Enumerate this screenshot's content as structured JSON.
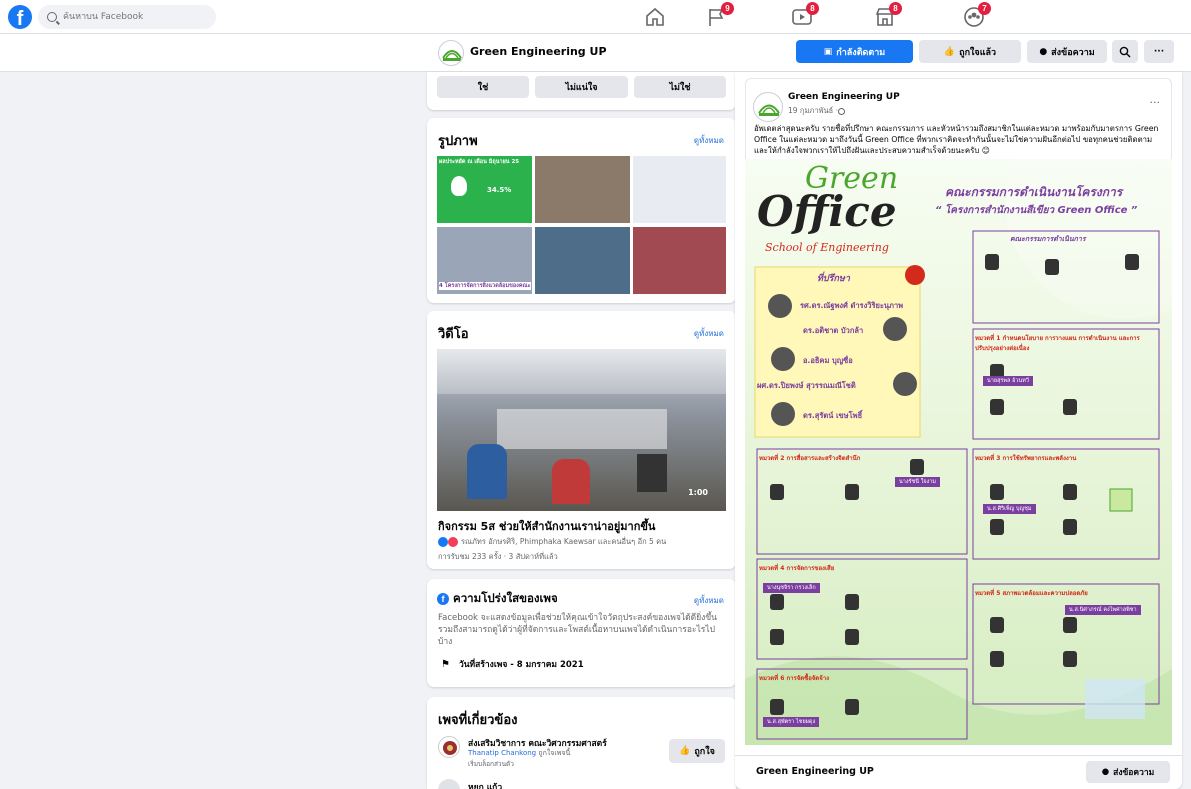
{
  "topbar": {
    "search_placeholder": "ค้นหาบน Facebook",
    "nav": [
      {
        "icon": "home-icon",
        "badge": ""
      },
      {
        "icon": "flag-icon",
        "badge": "9"
      },
      {
        "icon": "watch-icon",
        "badge": "8"
      },
      {
        "icon": "marketplace-icon",
        "badge": "8"
      },
      {
        "icon": "groups-icon",
        "badge": "7"
      }
    ]
  },
  "pagebar": {
    "page_name": "Green Engineering UP",
    "following_label": "กำลังติดตาม",
    "liked_label": "ถูกใจแล้ว",
    "message_label": "ส่งข้อความ",
    "more_label": "···"
  },
  "vote": {
    "options": [
      "ใช่",
      "ไม่แน่ใจ",
      "ไม่ใช่"
    ]
  },
  "photos": {
    "title": "รูปภาพ",
    "see_all": "ดูทั้งหมด",
    "items": [
      {
        "color": "#2bb24c",
        "caption": "ผลประหยัด ณ เดือน มิถุนายน 25",
        "text": "34.5%"
      },
      {
        "color": "#8b7a6a",
        "caption": "",
        "text": ""
      },
      {
        "color": "#e8ebf2",
        "caption": "",
        "text": ""
      },
      {
        "color": "#9aa6b8",
        "caption": "4 โครงการจัดการสิ่งแวดล้อมของคณะ",
        "text": ""
      },
      {
        "color": "#4e6d88",
        "caption": "",
        "text": ""
      },
      {
        "color": "#a24a52",
        "caption": "",
        "text": ""
      }
    ]
  },
  "videos": {
    "title": "วิดีโอ",
    "see_all": "ดูทั้งหมด",
    "duration": "1:00",
    "video_title": "กิจกรรม 5ส ช่วยให้สำนักงานเราน่าอยู่มากขึ้น",
    "reactors": "รณภัทร อักษรศิริ, Phimphaka Kaewsar และคนอื่นๆ อีก 5 คน",
    "meta": "การรับชม 233 ครั้ง · 3 สัปดาห์ที่แล้ว"
  },
  "transparency": {
    "title": "ความโปร่งใสของเพจ",
    "see_all": "ดูทั้งหมด",
    "description": "Facebook จะแสดงข้อมูลเพื่อช่วยให้คุณเข้าใจวัตถุประสงค์ของเพจได้ดียิ่งขึ้น รวมถึงสามารถดูได้ว่าผู้ที่จัดการและโพสต์เนื้อหาบนเพจได้ดำเนินการอะไรไปบ้าง",
    "created": "วันที่สร้างเพจ - 8 มกราคม 2021"
  },
  "related": {
    "title": "เพจที่เกี่ยวข้อง",
    "pages": [
      {
        "name": "ส่งเสริมวิชาการ คณะวิศวกรรมศาสตร์",
        "liker": "Thanatip Chankong",
        "liker_suffix": "ถูกใจเพจนี้",
        "sub": "เริ่มบล็อกส่วนตัว",
        "like_label": "ถูกใจ"
      },
      {
        "name": "หยก แก้ว",
        "liker": "",
        "liker_suffix": "",
        "sub": "",
        "like_label": ""
      }
    ]
  },
  "post": {
    "author": "Green Engineering UP",
    "date": "19 กุมภาพันธ์ · ",
    "text": "อัพเดตล่าสุดนะครับ รายชื่อที่ปรึกษา คณะกรรมการ และหัวหน้ารวมถึงสมาชิกในแต่ละหมวด มาพร้อมกับมาตรการ Green Office ในแต่ละหมวด มาถึงวันนี้ Green Office ที่พวกเราคิดจะทำกันนั้นจะไม่ใช่ความฝันอีกต่อไป ขอทุกคนช่วยติดตามและให้กำลังใจพวกเราให้ไปถึงฝันและประสบความสำเร็จด้วยนะครับ 😊",
    "more_label": "···",
    "footer_name": "Green Engineering UP",
    "footer_message": "ส่งข้อความ"
  },
  "poster": {
    "logo_green": "Green",
    "logo_office": "Office",
    "school": "School of Engineering",
    "heading": "คณะกรรมการดำเนินงานโครงการ",
    "subheading": "“ โครงการสำนักงานสีเขียว Green Office ”",
    "advisors_title": "ที่ปรึกษา",
    "advisors": [
      "รศ.ดร.ณัฐพงศ์ ดำรงวิริยะนุภาพ",
      "ดร.อติชาต บัวกล้า",
      "อ.อธิคม บุญซื่อ",
      "ผศ.ดร.ปิยพงษ์ สุวรรณมณีโชติ",
      "ดร.สุรัตน์ เขษโพธิ์"
    ],
    "committee_title": "คณะกรรมการดำเนินการ",
    "sections": [
      {
        "title": "หมวดที่ 1 กำหนดนโยบาย การวางแผน การดำเนินงาน และการปรับปรุงอย่างต่อเนื่อง",
        "leader": "นายสุรพล อ้วนทวี"
      },
      {
        "title": "หมวดที่ 2 การสื่อสารและสร้างจิตสำนึก",
        "leader": "นางรัชนี ใจงาม"
      },
      {
        "title": "หมวดที่ 3 การใช้ทรัพยากรและพลังงาน",
        "leader": "น.ส.ศิริเพ็ญ บุญชุม"
      },
      {
        "title": "หมวดที่ 4 การจัดการของเสีย",
        "leader": "นางนุชจิรา กรวงเล็ก"
      },
      {
        "title": "หมวดที่ 5 สภาพแวดล้อมและความปลอดภัย",
        "leader": "น.ส.นิศาภรณ์ คงไพศาลพิชา"
      },
      {
        "title": "หมวดที่ 6 การจัดซื้อจัดจ้าง",
        "leader": "น.ส.สุพัตรา ไชยผดุง"
      }
    ]
  },
  "colors": {
    "brand": "#1877f2",
    "badge": "#e41e3f",
    "poster_green": "#4aa72c",
    "poster_purple": "#7b3fa0",
    "poster_red": "#d42a1c"
  }
}
